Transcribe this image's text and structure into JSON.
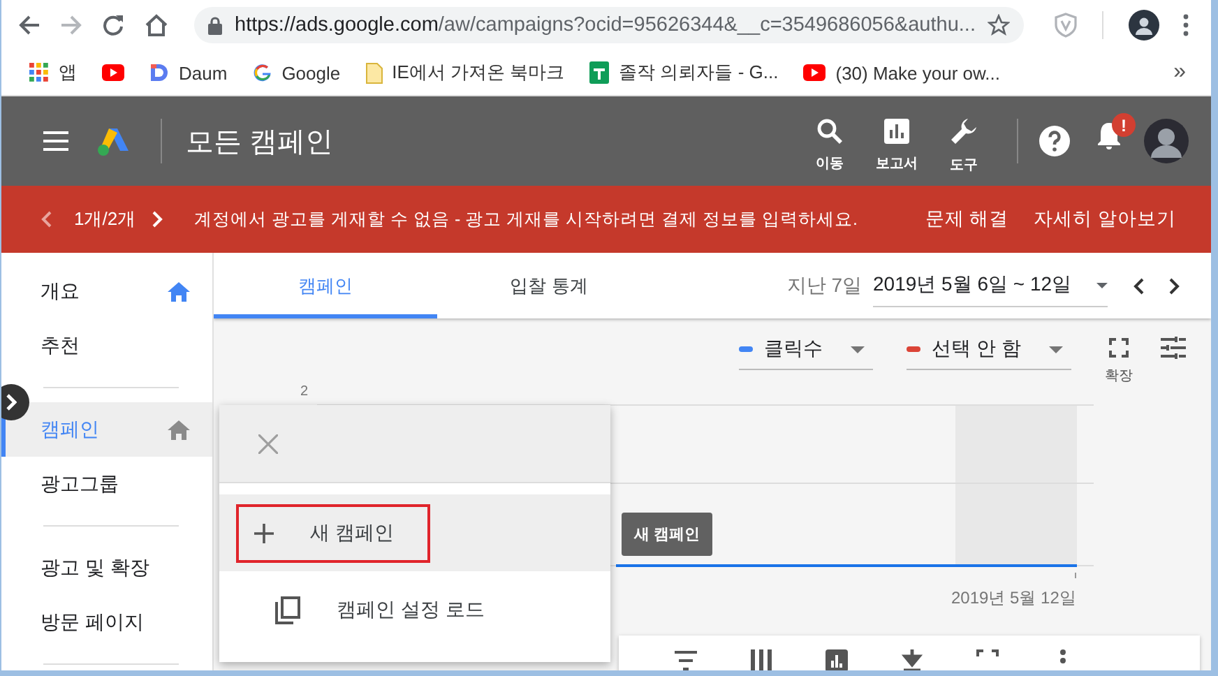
{
  "browser": {
    "url_host": "https://ads.google.com",
    "url_path": "/aw/campaigns?ocid=95626344&__c=3549686056&authu...",
    "bookmarks": [
      {
        "kind": "apps",
        "label": "앱"
      },
      {
        "kind": "youtube"
      },
      {
        "kind": "daum",
        "label": "Daum"
      },
      {
        "kind": "google",
        "label": "Google"
      },
      {
        "kind": "folder",
        "label": "IE에서 가져온 북마크"
      },
      {
        "kind": "sheet",
        "label": "졸작 의뢰자들 - G..."
      },
      {
        "kind": "youtube",
        "label": "(30) Make your ow..."
      }
    ],
    "overflow": "»"
  },
  "header": {
    "title": "모든 캠페인",
    "actions": [
      {
        "kind": "search",
        "label": "이동"
      },
      {
        "kind": "report",
        "label": "보고서"
      },
      {
        "kind": "tools",
        "label": "도구"
      }
    ],
    "notification_badge": "!"
  },
  "banner": {
    "counter": "1개/2개",
    "message": "계정에서 광고를 게재할 수 없음 - 광고 게재를 시작하려면 결제 정보를 입력하세요.",
    "links": [
      "문제 해결",
      "자세히 알아보기"
    ]
  },
  "sidebar": {
    "groups": [
      {
        "items": [
          {
            "label": "개요",
            "selected": false,
            "home_icon_active": true
          },
          {
            "label": "추천",
            "selected": false
          }
        ]
      },
      {
        "items": [
          {
            "label": "캠페인",
            "selected": true,
            "home_icon_active": false
          },
          {
            "label": "광고그룹",
            "selected": false
          }
        ]
      },
      {
        "items": [
          {
            "label": "광고 및 확장",
            "selected": false
          },
          {
            "label": "방문 페이지",
            "selected": false
          }
        ]
      }
    ]
  },
  "tabs": [
    {
      "label": "캠페인",
      "selected": true
    },
    {
      "label": "입찰 통계",
      "selected": false
    }
  ],
  "date_range": {
    "label": "지난 7일",
    "value": "2019년 5월 6일 ~ 12일"
  },
  "metrics": [
    {
      "label": "클릭수",
      "color": "#4285f4"
    },
    {
      "label": "선택 안 함",
      "color": "#db4437"
    }
  ],
  "expand_label": "확장",
  "chart": {
    "y_tick": "2",
    "x_label": "2019년 5월 12일"
  },
  "create_menu": {
    "items": [
      {
        "kind": "plus",
        "label": "새 캠페인",
        "highlighted": true
      },
      {
        "kind": "copy",
        "label": "캠페인 설정 로드",
        "highlighted": false
      }
    ]
  },
  "tooltip": "새 캠페인"
}
